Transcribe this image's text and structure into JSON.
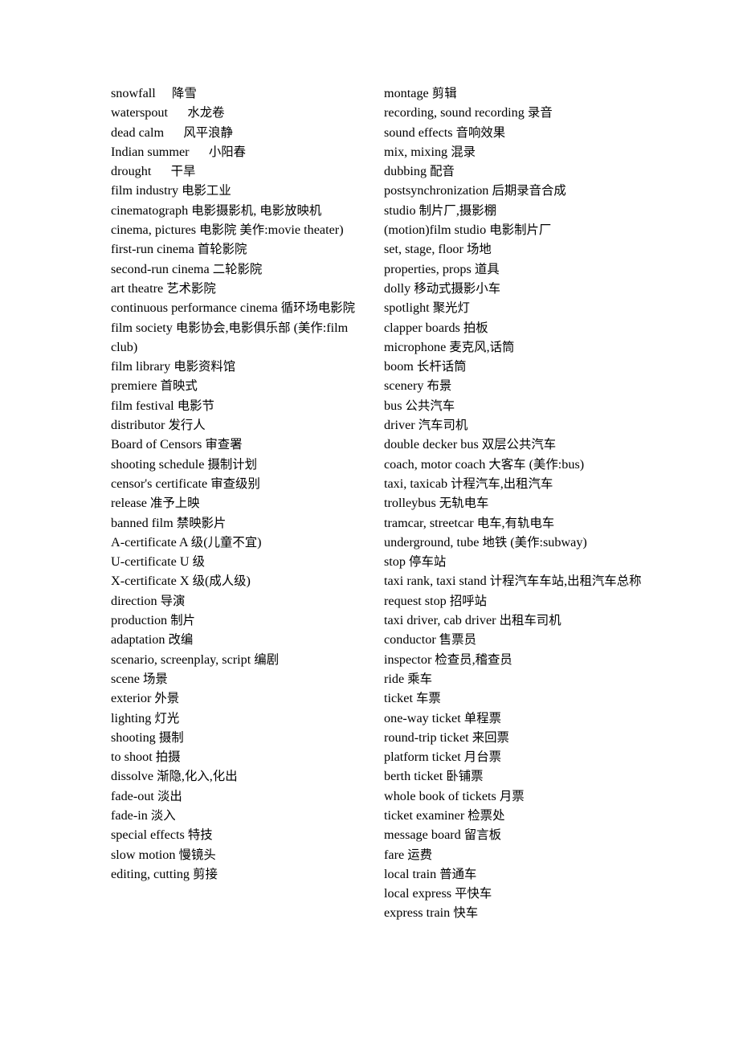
{
  "document": {
    "type": "bilingual-glossary",
    "background_color": "#ffffff",
    "text_color": "#000000",
    "columns": [
      {
        "name": "left-column",
        "entries": [
          "snowfall     降雪",
          "waterspout      水龙卷",
          "dead calm      风平浪静",
          "Indian summer      小阳春",
          "drought      干旱",
          "film industry 电影工业",
          "cinematograph 电影摄影机, 电影放映机",
          "cinema, pictures 电影院 美作:movie theater)",
          "first-run cinema 首轮影院",
          "second-run cinema 二轮影院",
          "art theatre 艺术影院",
          "continuous performance cinema 循环场电影院",
          "film society 电影协会,电影俱乐部 (美作:film club)",
          "film library 电影资料馆",
          "premiere 首映式",
          "film festival 电影节",
          "distributor 发行人",
          "Board of Censors 审查署",
          "shooting schedule 摄制计划",
          "censor's certificate 审查级别",
          "release 准予上映",
          "banned film 禁映影片",
          "A-certificate A 级(儿童不宜)",
          "U-certificate U 级",
          "X-certificate X 级(成人级)",
          "direction 导演",
          "production 制片",
          "adaptation 改编",
          "scenario, screenplay, script 编剧",
          "scene 场景",
          "exterior 外景",
          "lighting 灯光",
          "shooting 摄制",
          "to shoot 拍摄",
          "dissolve 渐隐,化入,化出",
          "fade-out 淡出",
          "fade-in 淡入",
          "special effects 特技",
          "slow motion 慢镜头",
          "editing, cutting 剪接"
        ]
      },
      {
        "name": "right-column",
        "entries": [
          "montage 剪辑",
          "recording, sound recording 录音",
          "sound effects 音响效果",
          "mix, mixing 混录",
          "dubbing 配音",
          "postsynchronization 后期录音合成",
          "studio 制片厂,摄影棚",
          "(motion)film studio 电影制片厂",
          "set, stage, floor 场地",
          "properties, props 道具",
          "dolly 移动式摄影小车",
          "spotlight 聚光灯",
          "clapper boards 拍板",
          "microphone 麦克风,话筒",
          "boom 长杆话筒",
          "scenery 布景",
          "bus 公共汽车",
          "driver 汽车司机",
          "double decker bus 双层公共汽车",
          "coach, motor coach 大客车 (美作:bus)",
          "taxi, taxicab 计程汽车,出租汽车",
          "trolleybus 无轨电车",
          "tramcar, streetcar 电车,有轨电车",
          "underground, tube 地铁 (美作:subway)",
          "stop 停车站",
          "taxi rank, taxi stand 计程汽车车站,出租汽车总称",
          "request stop 招呼站",
          "taxi driver, cab driver 出租车司机",
          "conductor 售票员",
          "inspector 检查员,稽查员",
          "ride 乘车",
          "ticket 车票",
          "one-way ticket 单程票",
          "round-trip ticket 来回票",
          "platform ticket 月台票",
          "berth ticket 卧铺票",
          "whole book of tickets 月票",
          "ticket examiner 检票处",
          "message board 留言板",
          "fare 运费",
          "local train 普通车",
          "local express 平快车",
          "express train 快车"
        ]
      }
    ]
  }
}
